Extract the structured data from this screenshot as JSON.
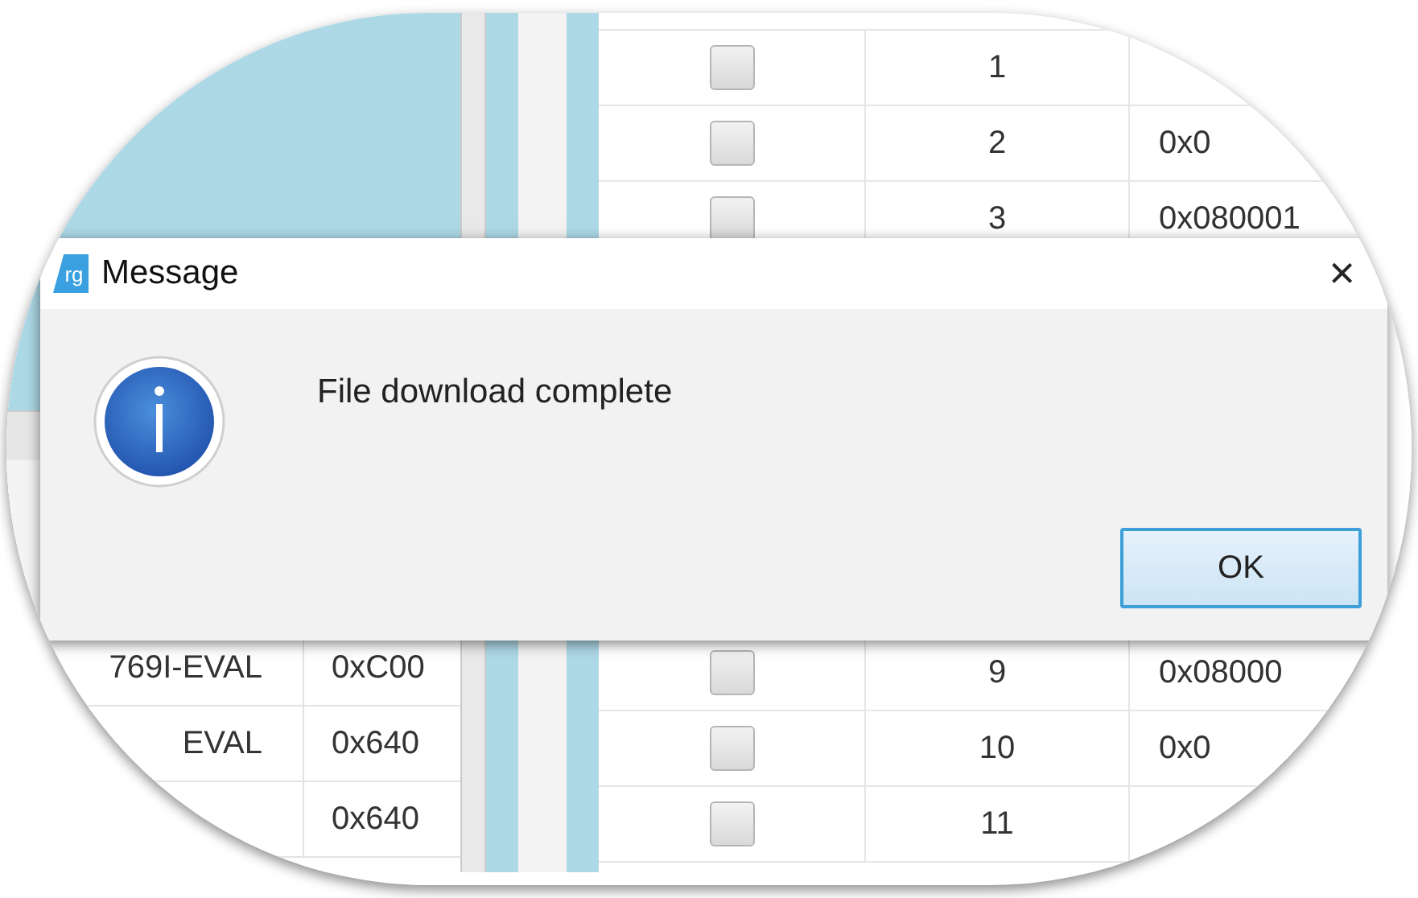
{
  "background_app": {
    "left_table": {
      "rows": [
        {
          "name": "769I-EVAL",
          "address": "0xC00"
        },
        {
          "name": "EVAL",
          "address": "0x640"
        },
        {
          "name": "",
          "address": "0x640"
        }
      ]
    },
    "right_table": {
      "top_rows": [
        {
          "checked": false,
          "index": "1",
          "address": ""
        },
        {
          "checked": false,
          "index": "2",
          "address": "0x0"
        },
        {
          "checked": false,
          "index": "3",
          "address": "0x080001"
        }
      ],
      "bottom_rows": [
        {
          "checked": false,
          "index": "9",
          "address": "0x08000"
        },
        {
          "checked": false,
          "index": "10",
          "address": "0x0"
        },
        {
          "checked": false,
          "index": "11",
          "address": ""
        }
      ]
    }
  },
  "dialog": {
    "logo": "rg",
    "title": "Message",
    "close": "×",
    "message": "File download complete",
    "buttons": [
      {
        "label": "OK",
        "selected": true
      }
    ]
  }
}
